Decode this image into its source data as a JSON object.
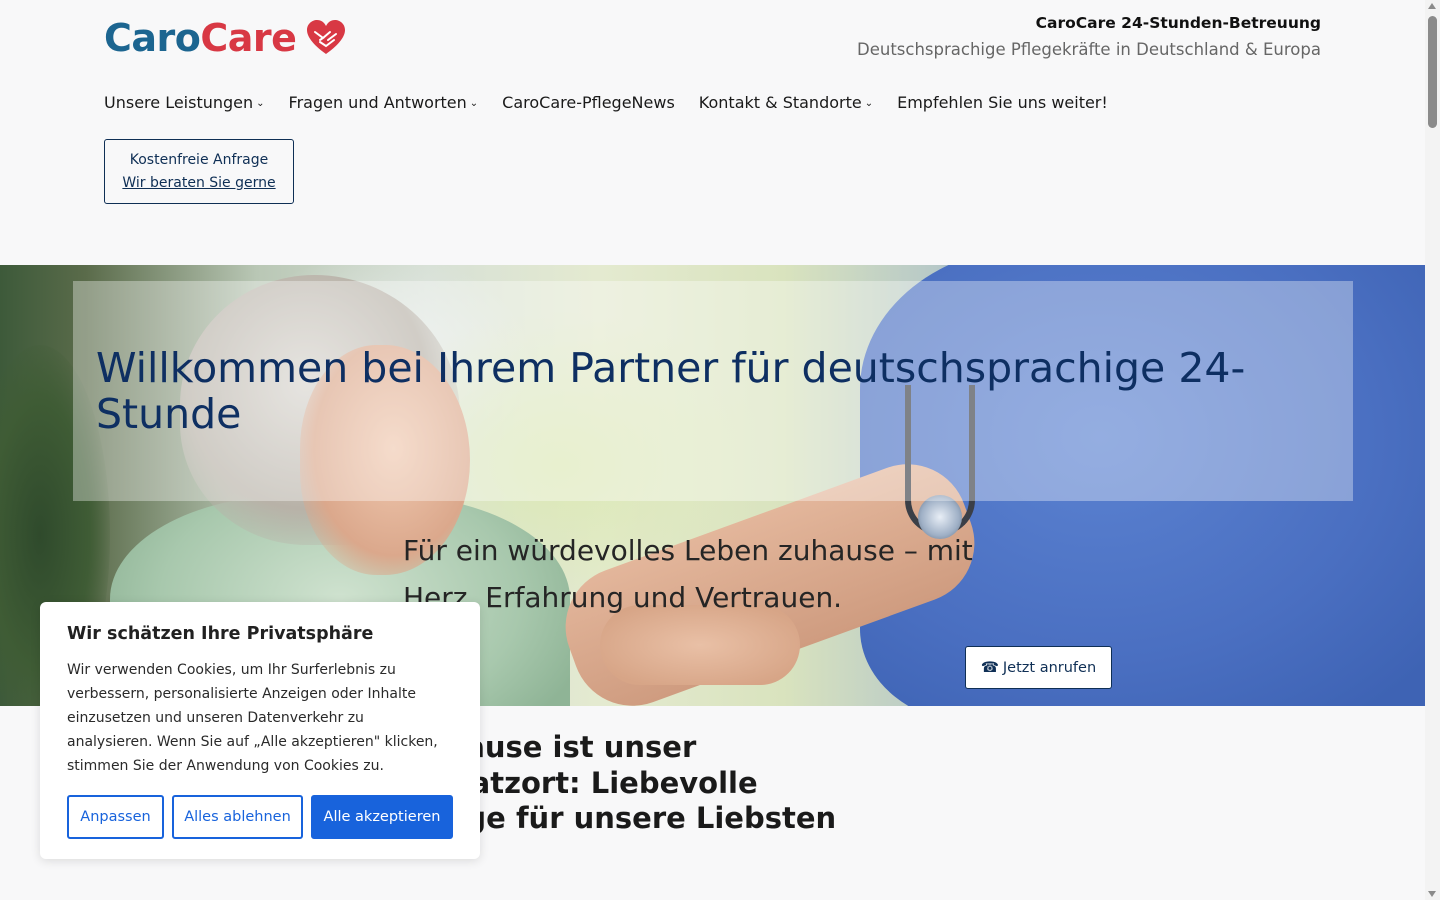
{
  "header": {
    "logo": {
      "part1": "Caro",
      "part2": "Care",
      "icon": "heart-hands-icon"
    },
    "brand_title": "CaroCare 24-Stunden-Betreuung",
    "brand_subtitle": "Deutschsprachige Pflegekräfte in Deutschland & Europa"
  },
  "nav": {
    "items": [
      {
        "label": "Unsere Leistungen",
        "dropdown": true
      },
      {
        "label": "Fragen und Antworten",
        "dropdown": true
      },
      {
        "label": "CaroCare-PflegeNews",
        "dropdown": false
      },
      {
        "label": "Kontakt & Standorte",
        "dropdown": true
      },
      {
        "label": "Empfehlen Sie uns weiter!",
        "dropdown": false
      }
    ],
    "caret": "⌄"
  },
  "cta": {
    "line1": "Kostenfreie Anfrage",
    "link": "Wir beraten Sie gerne"
  },
  "hero": {
    "title": "Willkommen bei Ihrem Partner für deutschsprachige 24-Stunde",
    "subtitle": "Für ein würdevolles Leben zuhause – mit Herz, Erfahrung und Vertrauen.",
    "call_icon": "☎",
    "call_label": "Jetzt anrufen"
  },
  "section": {
    "heading": "Zuhause ist unser Einsatzort: Liebevolle Pflege für unsere Liebsten"
  },
  "cookie": {
    "title": "Wir schätzen Ihre Privatsphäre",
    "text": "Wir verwenden Cookies, um Ihr Surferlebnis zu verbessern, personalisierte Anzeigen oder Inhalte einzusetzen und unseren Datenverkehr zu analysieren. Wenn Sie auf „Alle akzeptieren\" klicken, stimmen Sie der Anwendung von Cookies zu.",
    "btn_customize": "Anpassen",
    "btn_reject": "Alles ablehnen",
    "btn_accept": "Alle akzeptieren"
  },
  "colors": {
    "logo_blue": "#1c6590",
    "logo_red": "#d83844",
    "navy": "#0e2f62",
    "cookie_blue": "#1863dc"
  }
}
